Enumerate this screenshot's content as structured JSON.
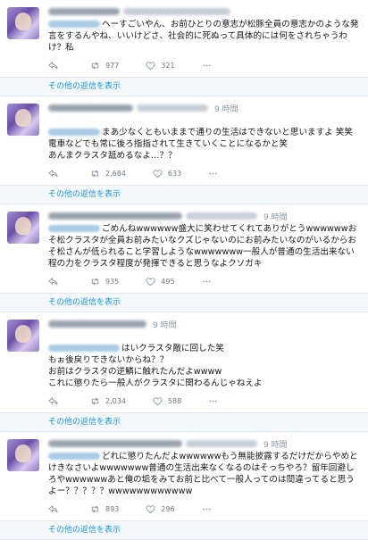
{
  "common": {
    "time_label": "9 時間",
    "more_replies": "その他の返信を表示"
  },
  "tweets": [
    {
      "text": "ヘーすごいやん、お前ひとりの意志が松豚全員の意志かのような発言をするんやね、いいけどさ、社会的に死ぬって具体的には何をされちゃうわけ？私",
      "retweets": "977",
      "likes": "321"
    },
    {
      "text": "まあ少なくともいままで通りの生活はできないと思いますよ 笑笑\n電車などでも常に後ろ指指されて生きていくことになるかと笑\nあんまクラスタ舐めるなよ…？？",
      "retweets": "2,684",
      "likes": "633"
    },
    {
      "text": "ごめんねwwwwww盛大に笑わせてくれてありがとうwwwwwwおそ松クラスタが全員お前みたいなクズじゃないのにお前みたいなのがいるからおそ松さんが低られること学習しようなwwwwwww一般人が普通の生活出来ない程の力をクラスタ程度が発揮できると思うなよクソガキ",
      "retweets": "935",
      "likes": "495"
    },
    {
      "text": "はいクラスタ敵に回した笑\nもぉ後戻りできないからね？？\nお前はクラスタの逆鱗に触れたんだよwwww\nこれに懲りたら一般人がクラスタに関わるんじゃねえよ",
      "retweets": "2,034",
      "likes": "588"
    },
    {
      "text": "どれに懲りたんだよwwwwwwもう無能披露するだけだからやめとけきなさいよwwwwwww普通の生活出来なくなるのはそっちやろ？留年回避しろやwwwwwwあと俺の垢をみてお前と比べて一般人ってのは間違ってると思うよー？？？？？wwwwwwwwwwww",
      "retweets": "893",
      "likes": "296"
    }
  ],
  "colors": {
    "link": "#1b95e0",
    "meta": "#8899a6",
    "action": "#657786",
    "divider": "#e1e8ed"
  },
  "icons": [
    "reply-icon",
    "retweet-icon",
    "like-icon",
    "more-icon"
  ]
}
